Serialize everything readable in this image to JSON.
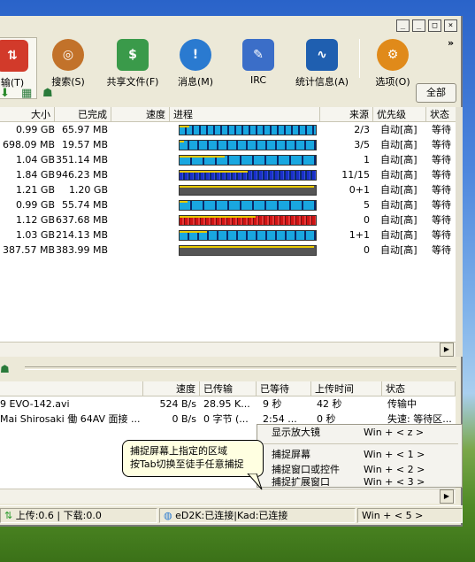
{
  "window": {
    "close_label": "×",
    "min_label": "_",
    "max_label": "□",
    "restore_label": "_",
    "chevron": "»"
  },
  "toolbar": {
    "items": [
      {
        "label": "输(T)",
        "icon": "transfer-icon"
      },
      {
        "label": "搜索(S)",
        "icon": "search-icon"
      },
      {
        "label": "共享文件(F)",
        "icon": "shared-files-icon"
      },
      {
        "label": "消息(M)",
        "icon": "messages-icon"
      },
      {
        "label": "IRC",
        "icon": "irc-icon"
      },
      {
        "label": "统计信息(A)",
        "icon": "statistics-icon"
      },
      {
        "label": "选项(O)",
        "icon": "options-icon"
      }
    ],
    "all_button": "全部"
  },
  "downloads": {
    "columns": [
      "大小",
      "已完成",
      "速度",
      "进程",
      "来源",
      "优先级",
      "状态"
    ],
    "rows": [
      {
        "size": "0.99 GB",
        "done": "65.97 MB",
        "speed": "",
        "progress": 0.07,
        "sources": "2/3",
        "priority": "自动[高]",
        "status": "等待"
      },
      {
        "size": "698.09 MB",
        "done": "19.57 MB",
        "speed": "",
        "progress": 0.03,
        "sources": "3/5",
        "priority": "自动[高]",
        "status": "等待"
      },
      {
        "size": "1.04 GB",
        "done": "351.14 MB",
        "speed": "",
        "progress": 0.33,
        "sources": "1",
        "priority": "自动[高]",
        "status": "等待"
      },
      {
        "size": "1.84 GB",
        "done": "946.23 MB",
        "speed": "",
        "progress": 0.5,
        "sources": "11/15",
        "priority": "自动[高]",
        "status": "等待"
      },
      {
        "size": "1.21 GB",
        "done": "1.20 GB",
        "speed": "",
        "progress": 0.99,
        "sources": "0+1",
        "priority": "自动[高]",
        "status": "等待"
      },
      {
        "size": "0.99 GB",
        "done": "55.74 MB",
        "speed": "",
        "progress": 0.06,
        "sources": "5",
        "priority": "自动[高]",
        "status": "等待"
      },
      {
        "size": "1.12 GB",
        "done": "637.68 MB",
        "speed": "",
        "progress": 0.56,
        "sources": "0",
        "priority": "自动[高]",
        "status": "等待"
      },
      {
        "size": "1.03 GB",
        "done": "214.13 MB",
        "speed": "",
        "progress": 0.2,
        "sources": "1+1",
        "priority": "自动[高]",
        "status": "等待"
      },
      {
        "size": "387.57 MB",
        "done": "383.99 MB",
        "speed": "",
        "progress": 0.99,
        "sources": "0",
        "priority": "自动[高]",
        "status": "等待"
      }
    ]
  },
  "uploads": {
    "columns": [
      "",
      "速度",
      "已传输",
      "已等待",
      "上传时间",
      "状态"
    ],
    "rows": [
      {
        "name": "9 EVO-142.avi",
        "speed": "524 B/s",
        "transferred": "28.95 K...",
        "waited": "9 秒",
        "upload_time": "42 秒",
        "status": "传输中"
      },
      {
        "name": "Mai Shirosaki 働 64AV 面接 ...",
        "speed": "0 B/s",
        "transferred": "0 字节 (...",
        "waited": "2:54 ...",
        "upload_time": "0 秒",
        "status": "失速: 等待区..."
      }
    ]
  },
  "popup_menu": {
    "items": [
      {
        "label": "显示放大镜",
        "shortcut": "Win + < z >"
      },
      {
        "label": "捕捉屏幕",
        "shortcut": "Win + < 1 >"
      },
      {
        "label": "捕捉窗口或控件",
        "shortcut": "Win + < 2 >"
      },
      {
        "label": "捕捉扩展窗口",
        "shortcut": "Win + < 3 >"
      },
      {
        "label": "",
        "shortcut": "Win + < 5 >"
      }
    ]
  },
  "tooltip": {
    "line1": "捕捉屏幕上指定的区域",
    "line2": "按Tab切换至徒手任意捕捉"
  },
  "statusbar": {
    "transfer": "上传:0.6 | 下载:0.0",
    "network": "eD2K:已连接|Kad:已连接"
  },
  "colors": {
    "bar_cyan": "#19a7e0",
    "bar_blue": "#1a2fc9",
    "bar_red": "#d01414",
    "bar_gray": "#555555",
    "bar_dark": "#0a2a6a"
  }
}
